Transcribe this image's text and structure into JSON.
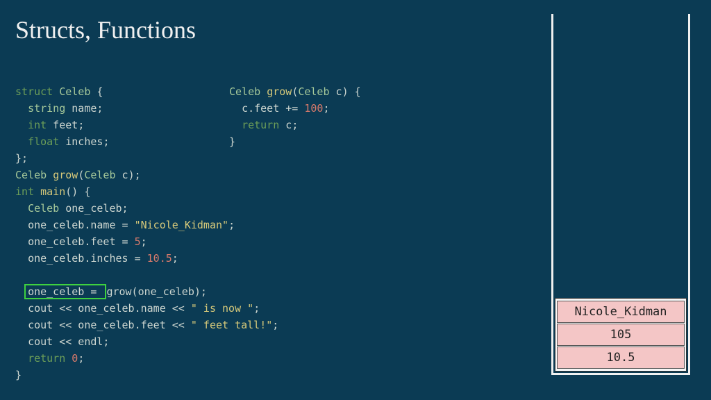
{
  "title": "Structs, Functions",
  "code_left": {
    "l1_kw": "struct",
    "l1_type": " Celeb ",
    "l1_pun": "{",
    "l2_indent": "  ",
    "l2_type": "string",
    "l2_id": " name",
    "l2_pun": ";",
    "l3_indent": "  ",
    "l3_kw": "int",
    "l3_id": " feet",
    "l3_pun": ";",
    "l4_indent": "  ",
    "l4_kw": "float",
    "l4_id": " inches",
    "l4_pun": ";",
    "l5": "};",
    "l6_type": "Celeb ",
    "l6_fn": "grow",
    "l6_pun1": "(",
    "l6_type2": "Celeb ",
    "l6_id": "c",
    "l6_pun2": ");",
    "l7_kw": "int",
    "l7_fn": " main",
    "l7_pun": "() {",
    "l8_indent": "  ",
    "l8_type": "Celeb ",
    "l8_id": "one_celeb",
    "l8_pun": ";",
    "l9_indent": "  ",
    "l9_id": "one_celeb.name = ",
    "l9_str": "\"Nicole_Kidman\"",
    "l9_pun": ";",
    "l10_indent": "  ",
    "l10_id": "one_celeb.feet = ",
    "l10_num": "5",
    "l10_pun": ";",
    "l11_indent": "  ",
    "l11_id": "one_celeb.inches = ",
    "l11_num": "10.5",
    "l11_pun": ";",
    "blank": " ",
    "l12_indent": "  ",
    "l12_hl": "one_celeb = ",
    "l12_rest": "grow(one_celeb);",
    "l13_indent": "  ",
    "l13_id": "cout << one_celeb.name << ",
    "l13_str": "\" is now \"",
    "l13_pun": ";",
    "l14_indent": "  ",
    "l14_id": "cout << one_celeb.feet << ",
    "l14_str": "\" feet tall!\"",
    "l14_pun": ";",
    "l15_indent": "  ",
    "l15_id": "cout << endl;",
    "l16_indent": "  ",
    "l16_kw": "return",
    "l16_num": " 0",
    "l16_pun": ";",
    "l17": "}"
  },
  "code_right": {
    "r1_type": "Celeb ",
    "r1_fn": "grow",
    "r1_pun1": "(",
    "r1_type2": "Celeb ",
    "r1_id": "c",
    "r1_pun2": ") {",
    "r2_indent": "  ",
    "r2_id": "c.feet += ",
    "r2_num": "100",
    "r2_pun": ";",
    "r3_indent": "  ",
    "r3_kw": "return",
    "r3_id": " c",
    "r3_pun": ";",
    "r4": "}"
  },
  "stack_cells": {
    "name": "Nicole_Kidman",
    "feet": "105",
    "inches": "10.5"
  }
}
